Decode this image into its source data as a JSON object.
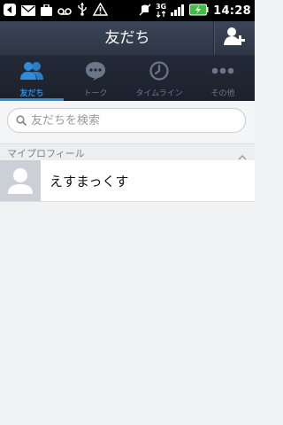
{
  "status_bar": {
    "time": "14:28",
    "network": "3G"
  },
  "header": {
    "title": "友だち"
  },
  "tabs": [
    {
      "label": "友だち",
      "icon": "friends-icon",
      "active": true
    },
    {
      "label": "トーク",
      "icon": "chat-bubble-icon",
      "active": false
    },
    {
      "label": "タイムライン",
      "icon": "clock-icon",
      "active": false
    },
    {
      "label": "その他",
      "icon": "more-dots-icon",
      "active": false
    }
  ],
  "search": {
    "placeholder": "友だちを検索"
  },
  "section": {
    "title": "マイプロフィール"
  },
  "profile": {
    "name": "えすまっくす"
  },
  "colors": {
    "accent": "#2f8cdc",
    "header_bg": "#353f50",
    "tab_bg": "#1f2530",
    "inactive_tab": "#6c7689",
    "battery": "#3fbf3f"
  }
}
